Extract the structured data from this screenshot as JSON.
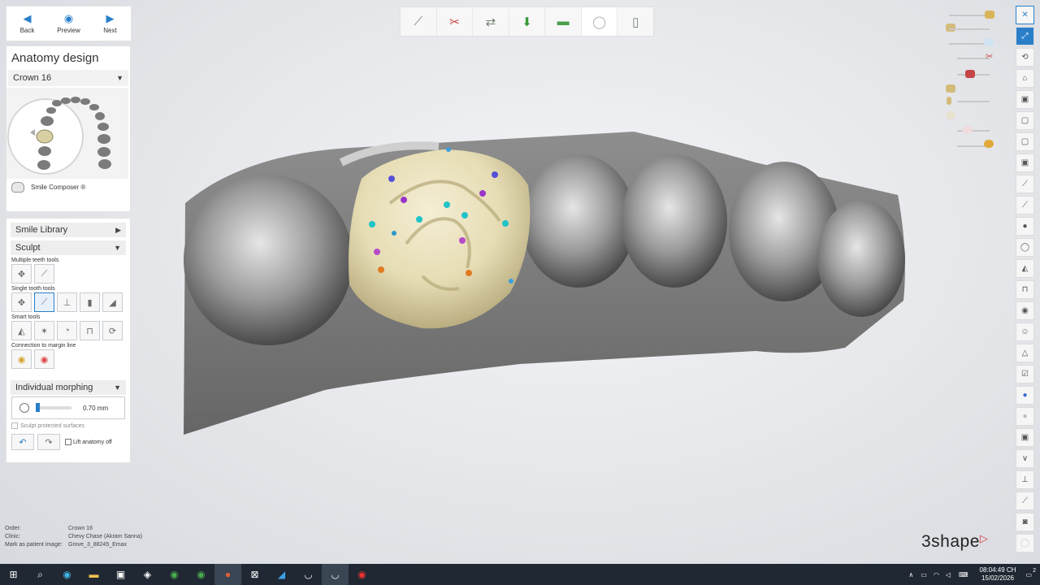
{
  "nav": {
    "back": "Back",
    "preview": "Preview",
    "next": "Next"
  },
  "panel": {
    "title": "Anatomy design",
    "crown_select": "Crown 16",
    "smile_composer": "Smile Composer ®",
    "smile_library": "Smile Library",
    "sculpt": "Sculpt",
    "multiple_teeth_tools": "Multiple teeth tools",
    "single_tooth_tools": "Single tooth tools",
    "smart_tools": "Smart tools",
    "connection_margin": "Connection to margin line",
    "individual_morphing": "Individual morphing",
    "morph_value": "0.70 mm",
    "sculpt_protected": "Sculpt protected surfaces",
    "lift_anatomy": "Lift anatomy off"
  },
  "info": {
    "order_label": "Order:",
    "order_value": "Crown 16",
    "clinic_label": "Clinic:",
    "clinic_value": "Chevy Chase (Akram Sanna)",
    "mark_label": "Mark as patient image:",
    "mark_value": "Grove_3_88245_Emax"
  },
  "brand": {
    "logo": "3shape"
  },
  "taskbar": {
    "time": "08:04:49 CH",
    "date": "15/02/2026",
    "notif": "2"
  },
  "colors": {
    "accent": "#2a7fc9",
    "crown": "#ece4c2",
    "taskbar": "#202833"
  }
}
